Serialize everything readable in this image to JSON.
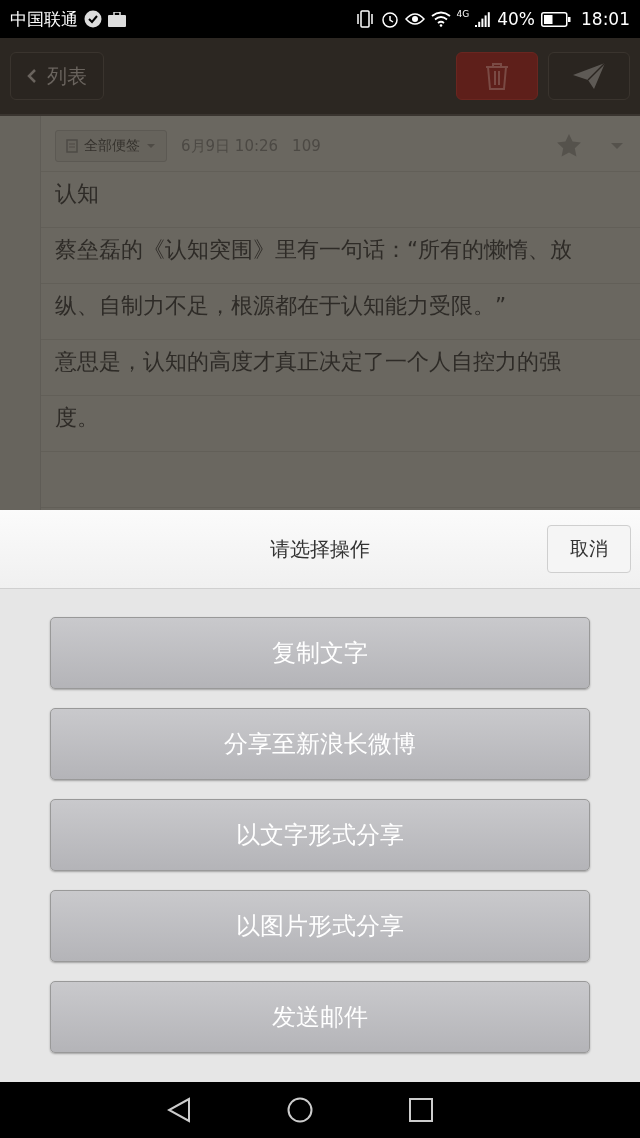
{
  "status_bar": {
    "carrier": "中国联通",
    "network": "4G",
    "battery": "40%",
    "time": "18:01"
  },
  "toolbar": {
    "back_label": "列表"
  },
  "note": {
    "folder": "全部便签",
    "date": "6月9日 10:26",
    "count": "109",
    "starred": false,
    "title": "认知",
    "paragraphs": [
      "蔡垒磊的《认知突围》里有一句话：“所有的懒惰、放纵、自制力不足，根源都在于认知能力受限。”",
      "意思是，认知的高度才真正决定了一个人自控力的强度。"
    ]
  },
  "action_sheet": {
    "title": "请选择操作",
    "cancel": "取消",
    "actions": [
      "复制文字",
      "分享至新浪长微博",
      "以文字形式分享",
      "以图片形式分享",
      "发送邮件"
    ]
  }
}
